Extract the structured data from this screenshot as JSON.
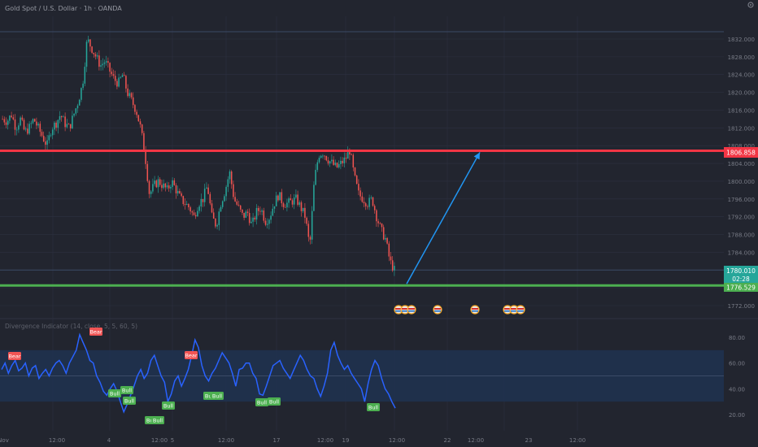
{
  "header": {
    "title": "Gold Spot / U.S. Dollar · 1h · OANDA"
  },
  "colors": {
    "background": "#22252f",
    "grid": "#2d3140",
    "candle_up": "#26a69a",
    "candle_down": "#ef5350",
    "resistance_line": "#f23645",
    "support_line": "#4caf50",
    "arrow": "#2196f3",
    "rsi_line": "#2962ff",
    "rsi_band": "#1f3350",
    "axis_text": "#787b86"
  },
  "price_axis": {
    "labels": [
      "1832.000",
      "1828.000",
      "1824.000",
      "1820.000",
      "1816.000",
      "1812.000",
      "1808.000",
      "1804.000",
      "1800.000",
      "1796.000",
      "1792.000",
      "1788.000",
      "1784.000",
      "1780.000",
      "1776.000",
      "1772.000"
    ]
  },
  "price_badges": {
    "resistance": "1806.858",
    "current_price": "1780.010",
    "countdown": "02:28",
    "support": "1776.529"
  },
  "rsi": {
    "title": "Divergence Indicator (14, close, 5, 5, 60, 5)",
    "levels": [
      "80.00",
      "60.00",
      "40.00",
      "20.00"
    ],
    "bull_label": "Bull",
    "bear_label": "Bear"
  },
  "time_axis": {
    "labels": [
      "Nov",
      "12:00",
      "4",
      "12:00",
      "5",
      "12:00",
      "17",
      "12:00",
      "19",
      "12:00",
      "22",
      "12:00",
      "23",
      "12:00"
    ]
  },
  "settings_icon": "gear-icon",
  "chart_data": {
    "type": "line",
    "title": "Gold Spot / U.S. Dollar · 1h · OANDA",
    "xlabel": "",
    "ylabel": "",
    "ylim": [
      1770,
      1836
    ],
    "series": [
      {
        "values": [
          1814,
          1813.5,
          1815,
          1812,
          1814,
          1811,
          1812,
          1814,
          1812,
          1810,
          1808,
          1812,
          1813,
          1815,
          1813,
          1812,
          1815,
          1818,
          1822,
          1832,
          1830,
          1828,
          1826,
          1827,
          1825,
          1823,
          1822,
          1824,
          1820,
          1818,
          1816,
          1812,
          1806,
          1797,
          1799,
          1800,
          1799,
          1798,
          1800,
          1798,
          1796,
          1795,
          1794,
          1792,
          1795,
          1796,
          1799,
          1792,
          1790,
          1795,
          1798,
          1802,
          1796,
          1794,
          1792,
          1793,
          1790,
          1793,
          1794,
          1791,
          1792,
          1795,
          1797,
          1795,
          1795,
          1795.5,
          1796,
          1794,
          1792,
          1785,
          1800,
          1806,
          1806.5,
          1805,
          1804,
          1803,
          1804,
          1805,
          1807,
          1801,
          1797,
          1796,
          1795,
          1796,
          1792,
          1789,
          1787,
          1782,
          1780
        ]
      }
    ],
    "levels": {
      "resistance": 1806.858,
      "support": 1776.529,
      "current": 1780.01
    },
    "projection": {
      "from": 1776.529,
      "to": 1806.858
    },
    "rsi_panel": {
      "ylim": [
        15,
        90
      ],
      "band": [
        30,
        70
      ],
      "values": [
        55,
        60,
        52,
        58,
        62,
        54,
        56,
        60,
        50,
        56,
        58,
        48,
        52,
        55,
        50,
        56,
        60,
        62,
        58,
        52,
        60,
        65,
        70,
        82,
        76,
        70,
        62,
        60,
        50,
        45,
        38,
        35,
        40,
        44,
        38,
        30,
        22,
        28,
        35,
        42,
        50,
        55,
        48,
        52,
        62,
        66,
        58,
        50,
        45,
        30,
        36,
        46,
        50,
        42,
        48,
        55,
        66,
        78,
        72,
        58,
        50,
        46,
        52,
        56,
        62,
        68,
        64,
        60,
        52,
        42,
        55,
        56,
        60,
        60,
        52,
        48,
        36,
        35,
        42,
        50,
        58,
        60,
        62,
        56,
        52,
        48,
        54,
        60,
        66,
        62,
        55,
        50,
        48,
        40,
        34,
        42,
        52,
        70,
        76,
        66,
        60,
        55,
        58,
        52,
        48,
        44,
        40,
        30,
        44,
        55,
        62,
        58,
        48,
        40,
        36,
        30,
        25
      ]
    }
  }
}
